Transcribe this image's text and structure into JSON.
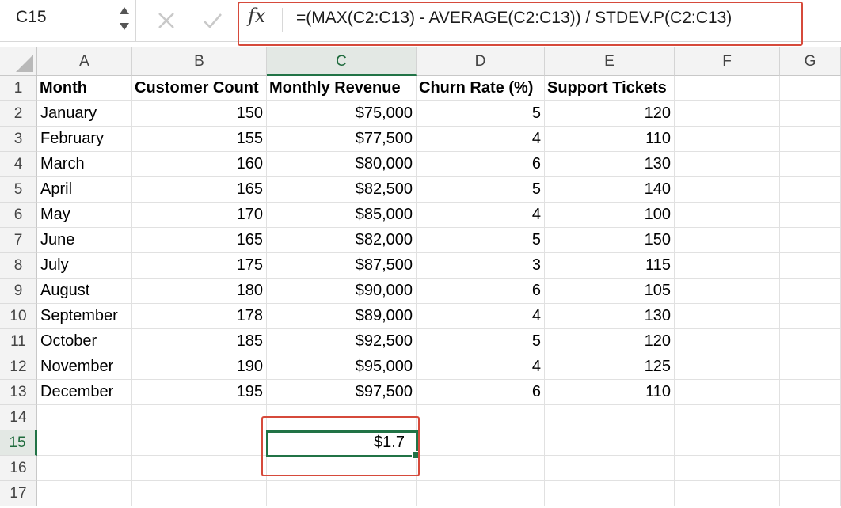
{
  "formula_bar": {
    "name_box": "C15",
    "fx_label": "fx",
    "formula": "=(MAX(C2:C13) - AVERAGE(C2:C13)) / STDEV.P(C2:C13)"
  },
  "columns": [
    "A",
    "B",
    "C",
    "D",
    "E",
    "F",
    "G"
  ],
  "active_column": "C",
  "active_row": "15",
  "row_numbers": [
    "1",
    "2",
    "3",
    "4",
    "5",
    "6",
    "7",
    "8",
    "9",
    "10",
    "11",
    "12",
    "13",
    "14",
    "15",
    "16",
    "17"
  ],
  "headers": [
    "Month",
    "Customer Count",
    "Monthly Revenue",
    "Churn Rate (%)",
    "Support Tickets"
  ],
  "data_rows": [
    [
      "January",
      "150",
      "$75,000",
      "5",
      "120"
    ],
    [
      "February",
      "155",
      "$77,500",
      "4",
      "110"
    ],
    [
      "March",
      "160",
      "$80,000",
      "6",
      "130"
    ],
    [
      "April",
      "165",
      "$82,500",
      "5",
      "140"
    ],
    [
      "May",
      "170",
      "$85,000",
      "4",
      "100"
    ],
    [
      "June",
      "165",
      "$82,000",
      "5",
      "150"
    ],
    [
      "July",
      "175",
      "$87,500",
      "3",
      "115"
    ],
    [
      "August",
      "180",
      "$90,000",
      "6",
      "105"
    ],
    [
      "September",
      "178",
      "$89,000",
      "4",
      "130"
    ],
    [
      "October",
      "185",
      "$92,500",
      "5",
      "120"
    ],
    [
      "November",
      "190",
      "$95,000",
      "4",
      "125"
    ],
    [
      "December",
      "195",
      "$97,500",
      "6",
      "110"
    ]
  ],
  "result_cell": {
    "ref": "C15",
    "value": "$1.7"
  },
  "colors": {
    "selection": "#217346",
    "highlight": "#d64a3b"
  }
}
